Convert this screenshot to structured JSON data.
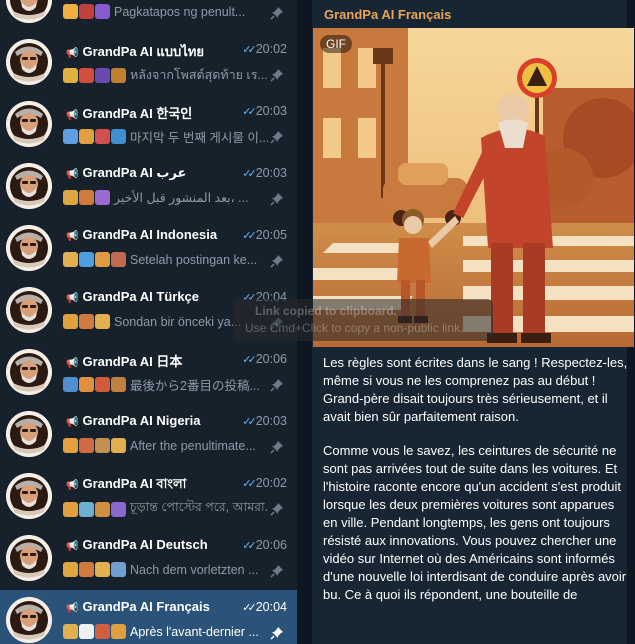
{
  "chats": [
    {
      "title": "",
      "time": "",
      "preview": "Pagkatapos ng penult...",
      "active": false,
      "emoji": [
        "#f0b040",
        "#c04040",
        "#8a5ad0"
      ]
    },
    {
      "title": "GrandPa AI แบบไทย",
      "time": "20:02",
      "preview": "หลังจากโพสต์สุดท้าย เร...",
      "active": false,
      "emoji": [
        "#e0b040",
        "#d04f3f",
        "#6a4ab0",
        "#c08030"
      ]
    },
    {
      "title": "GrandPa AI 한국인",
      "time": "20:03",
      "preview": "마지막 두 번째 게시물 이...",
      "active": false,
      "emoji": [
        "#5f9fe0",
        "#e2a040",
        "#d05050",
        "#3f8fd0"
      ]
    },
    {
      "title": "GrandPa AI عرب",
      "time": "20:03",
      "preview": "بعد المنشور قبل الأخير، ...",
      "active": false,
      "emoji": [
        "#e0a540",
        "#d07a40",
        "#9a6ad0"
      ]
    },
    {
      "title": "GrandPa AI Indonesia",
      "time": "20:05",
      "preview": "Setelah postingan ke...",
      "active": false,
      "emoji": [
        "#e3b050",
        "#4f9fe0",
        "#e09a40",
        "#c06a50"
      ]
    },
    {
      "title": "GrandPa AI Türkçe",
      "time": "20:04",
      "preview": "Sondan bir önceki ya...",
      "active": false,
      "emoji": [
        "#e0a040",
        "#d07a40",
        "#e3b050"
      ]
    },
    {
      "title": "GrandPa AI 日本",
      "time": "20:06",
      "preview": "最後から2番目の投稿...",
      "active": false,
      "emoji": [
        "#4f8fd0",
        "#e09040",
        "#d05a3a",
        "#c08040"
      ]
    },
    {
      "title": "GrandPa AI Nigeria",
      "time": "20:03",
      "preview": "After the penultimate...",
      "active": false,
      "emoji": [
        "#e2a040",
        "#d06a40",
        "#c09050",
        "#e0b050"
      ]
    },
    {
      "title": "GrandPa AI বাংলা",
      "time": "20:02",
      "preview": "চূড়ান্ত পোস্টের পরে, আমরা...",
      "active": false,
      "emoji": [
        "#e0a040",
        "#6fb0d0",
        "#d09040",
        "#8a6ad0"
      ]
    },
    {
      "title": "GrandPa AI Deutsch",
      "time": "20:06",
      "preview": "Nach dem vorletzten ...",
      "active": false,
      "emoji": [
        "#e0a540",
        "#d07a40",
        "#e3b050",
        "#6f9fd0"
      ]
    },
    {
      "title": "GrandPa AI Français",
      "time": "20:04",
      "preview": "Après l'avant-dernier ...",
      "active": true,
      "emoji": [
        "#e0b050",
        "#f0f0f0",
        "#d06040",
        "#e0a040"
      ]
    }
  ],
  "colors": {
    "sidebar_bg": "#17212b",
    "active_row": "#2b5278",
    "pane_bg": "#0e1621",
    "bubble_bg": "#182533",
    "sender": "#e8a55a",
    "tick": "#6ab2f2"
  },
  "message": {
    "sender": "GrandPa AI Français",
    "badge": "GIF",
    "paragraphs": [
      "Les règles sont écrites dans le sang ! Respectez-les, même si vous ne les comprenez pas au début ! Grand-père disait toujours très sérieusement, et il avait bien sûr parfaitement raison.",
      "Comme vous le savez, les ceintures de sécurité ne sont pas arrivées tout de suite dans les voitures. Et l'histoire raconte encore qu'un accident s'est produit lorsque les deux premières voitures sont apparues en ville. Pendant longtemps, les gens ont toujours résisté aux innovations. Vous pouvez chercher une vidéo sur Internet où des Américains sont informés d'une nouvelle loi interdisant de conduire après avoir bu. Ce à quoi ils répondent, une bouteille de"
    ]
  },
  "toast": {
    "title": "Link copied to clipboard.",
    "subtitle": "Use Cmd+Click to copy a non-public link."
  },
  "icons": {
    "speaker": "megaphone-icon",
    "read": "double-check-icon",
    "pin": "pin-icon"
  }
}
